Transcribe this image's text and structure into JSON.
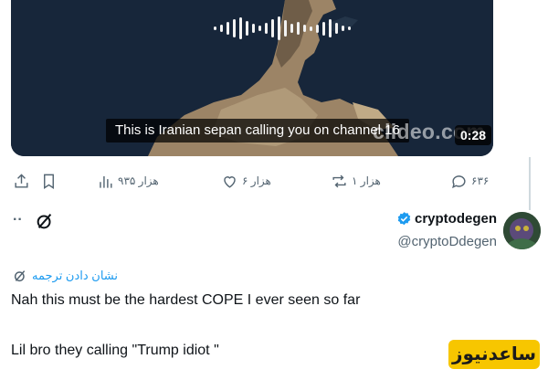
{
  "media": {
    "caption": "This is Iranian sepan calling you on channel 16",
    "watermark": "clideo.com",
    "duration": "0:28"
  },
  "actions": {
    "replies": "۶۳۶",
    "retweets": "هزار ۱",
    "likes": "هزار ۶",
    "views": "هزار ۹۳۵"
  },
  "reply": {
    "author_name": "cryptodegen",
    "handle": "@cryptoDdegen",
    "more": "··",
    "translate": "نشان دادن ترجمه",
    "lines": [
      "Nah this must be  the hardest COPE I ever seen so far",
      "Lil bro they calling \"Trump idiot \""
    ]
  },
  "brand": {
    "label": "ساعدنیوز"
  },
  "colors": {
    "accent": "#1d9bf0",
    "muted": "#536471",
    "brand_yellow": "#f7c600"
  }
}
